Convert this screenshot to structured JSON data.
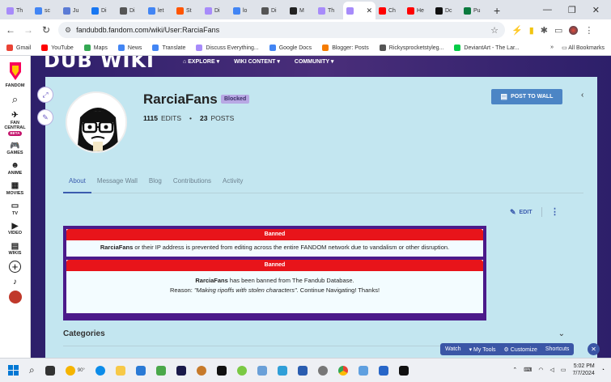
{
  "browser": {
    "tabs": [
      {
        "label": "Th",
        "color": "#a78bfa"
      },
      {
        "label": "sc",
        "color": "#4285f4"
      },
      {
        "label": "Ju",
        "color": "#5b7bd5"
      },
      {
        "label": "Di",
        "color": "#1877f2"
      },
      {
        "label": "Di",
        "color": "#555555"
      },
      {
        "label": "let",
        "color": "#4285f4"
      },
      {
        "label": "St",
        "color": "#ff5500"
      },
      {
        "label": "Di",
        "color": "#a78bfa"
      },
      {
        "label": "lo",
        "color": "#4285f4"
      },
      {
        "label": "Di",
        "color": "#555555"
      },
      {
        "label": "M",
        "color": "#222222"
      },
      {
        "label": "Th",
        "color": "#a78bfa"
      },
      {
        "label": "",
        "color": "#a78bfa",
        "active": true
      },
      {
        "label": "Ch",
        "color": "#ff0000"
      },
      {
        "label": "He",
        "color": "#ff0000"
      },
      {
        "label": "Dc",
        "color": "#111111"
      },
      {
        "label": "Pu",
        "color": "#0b7a3e"
      }
    ],
    "url": "fandubdb.fandom.com/wiki/User:RarciaFans",
    "bookmarks": [
      {
        "label": "Gmail",
        "color": "#ea4335"
      },
      {
        "label": "YouTube",
        "color": "#ff0000"
      },
      {
        "label": "Maps",
        "color": "#34a853"
      },
      {
        "label": "News",
        "color": "#4285f4"
      },
      {
        "label": "Translate",
        "color": "#4285f4"
      },
      {
        "label": "Discuss Everything...",
        "color": "#a78bfa"
      },
      {
        "label": "Google Docs",
        "color": "#4285f4"
      },
      {
        "label": "Blogger: Posts",
        "color": "#f57c00"
      },
      {
        "label": "Rickysprocketstyleg...",
        "color": "#555555"
      },
      {
        "label": "DeviantArt - The Lar...",
        "color": "#05cc47"
      }
    ],
    "all_bookmarks": "All Bookmarks"
  },
  "fandom_sidebar": {
    "logo": "FANDOM",
    "items": [
      {
        "label": "FAN CENTRAL",
        "badge": "BETA"
      },
      {
        "label": "GAMES"
      },
      {
        "label": "ANIME"
      },
      {
        "label": "MOVIES"
      },
      {
        "label": "TV"
      },
      {
        "label": "VIDEO"
      },
      {
        "label": "WIKIS"
      }
    ]
  },
  "wiki_nav": {
    "logo": "DUB WIKI",
    "explore": "EXPLORE",
    "wiki_content": "WIKI CONTENT",
    "community": "COMMUNITY"
  },
  "profile": {
    "username": "RarciaFans",
    "status_badge": "Blocked",
    "edits_count": "1115",
    "edits_label": "EDITS",
    "posts_count": "23",
    "posts_label": "POSTS",
    "post_to_wall": "POST TO WALL",
    "tabs": [
      "About",
      "Message Wall",
      "Blog",
      "Contributions",
      "Activity"
    ],
    "active_tab": "About",
    "edit_label": "EDIT"
  },
  "notices": [
    {
      "title": "Banned",
      "name": "RarciaFans",
      "text": " or their IP address is prevented from editing across the entire FANDOM network due to vandalism or other disruption."
    },
    {
      "title": "Banned",
      "name": "RarciaFans",
      "text": " has been banned from The Fandub Database.",
      "reason_prefix": "Reason: ",
      "reason": "\"Making ripoffs with stolen characters\"",
      "reason_suffix": ". Continue Navigating! Thanks!"
    }
  ],
  "categories_label": "Categories",
  "bottom_toolbar": {
    "watch": "Watch",
    "my_tools": "My Tools",
    "customize": "Customize",
    "shortcuts": "Shortcuts"
  },
  "taskbar": {
    "weather": "90°",
    "time": "5:02 PM",
    "date": "7/7/2024"
  }
}
